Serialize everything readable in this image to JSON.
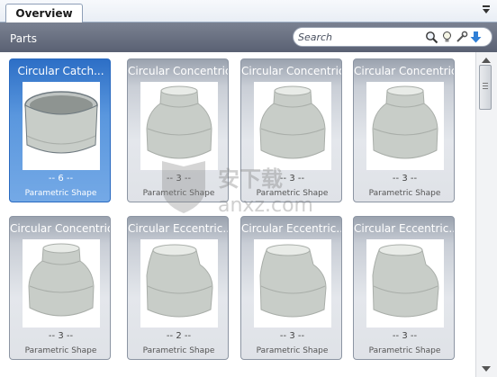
{
  "tabs": [
    {
      "label": "Overview"
    }
  ],
  "panel": {
    "menu_icon": "panel-menu-icon"
  },
  "header": {
    "title": "Parts",
    "search": {
      "placeholder": "Search",
      "value": ""
    },
    "tools": [
      "magnifier-icon",
      "lightbulb-icon",
      "wrench-icon",
      "download-arrow-icon"
    ]
  },
  "tiles": [
    {
      "title": "Circular Catch...",
      "count": "-- 6 --",
      "subtitle": "Parametric Shape",
      "selected": true,
      "shape": "catchbasin"
    },
    {
      "title": "Circular Concentric...",
      "count": "-- 3 --",
      "subtitle": "Parametric Shape",
      "selected": false,
      "shape": "concentric"
    },
    {
      "title": "Circular Concentric...",
      "count": "-- 3 --",
      "subtitle": "Parametric Shape",
      "selected": false,
      "shape": "concentric"
    },
    {
      "title": "Circular Concentric...",
      "count": "-- 3 --",
      "subtitle": "Parametric Shape",
      "selected": false,
      "shape": "concentric"
    },
    {
      "title": "Circular Concentric...",
      "count": "-- 3 --",
      "subtitle": "Parametric Shape",
      "selected": false,
      "shape": "concentric"
    },
    {
      "title": "Circular Eccentric...",
      "count": "-- 2 --",
      "subtitle": "Parametric Shape",
      "selected": false,
      "shape": "eccentric"
    },
    {
      "title": "Circular Eccentric...",
      "count": "-- 3 --",
      "subtitle": "Parametric Shape",
      "selected": false,
      "shape": "eccentric"
    },
    {
      "title": "Circular Eccentric...",
      "count": "-- 3 --",
      "subtitle": "Parametric Shape",
      "selected": false,
      "shape": "eccentric"
    }
  ],
  "watermark": {
    "text": "anxz.com"
  },
  "colors": {
    "header": "#616878",
    "selection": "#3d7fd1",
    "tile": "#d5d9df"
  }
}
